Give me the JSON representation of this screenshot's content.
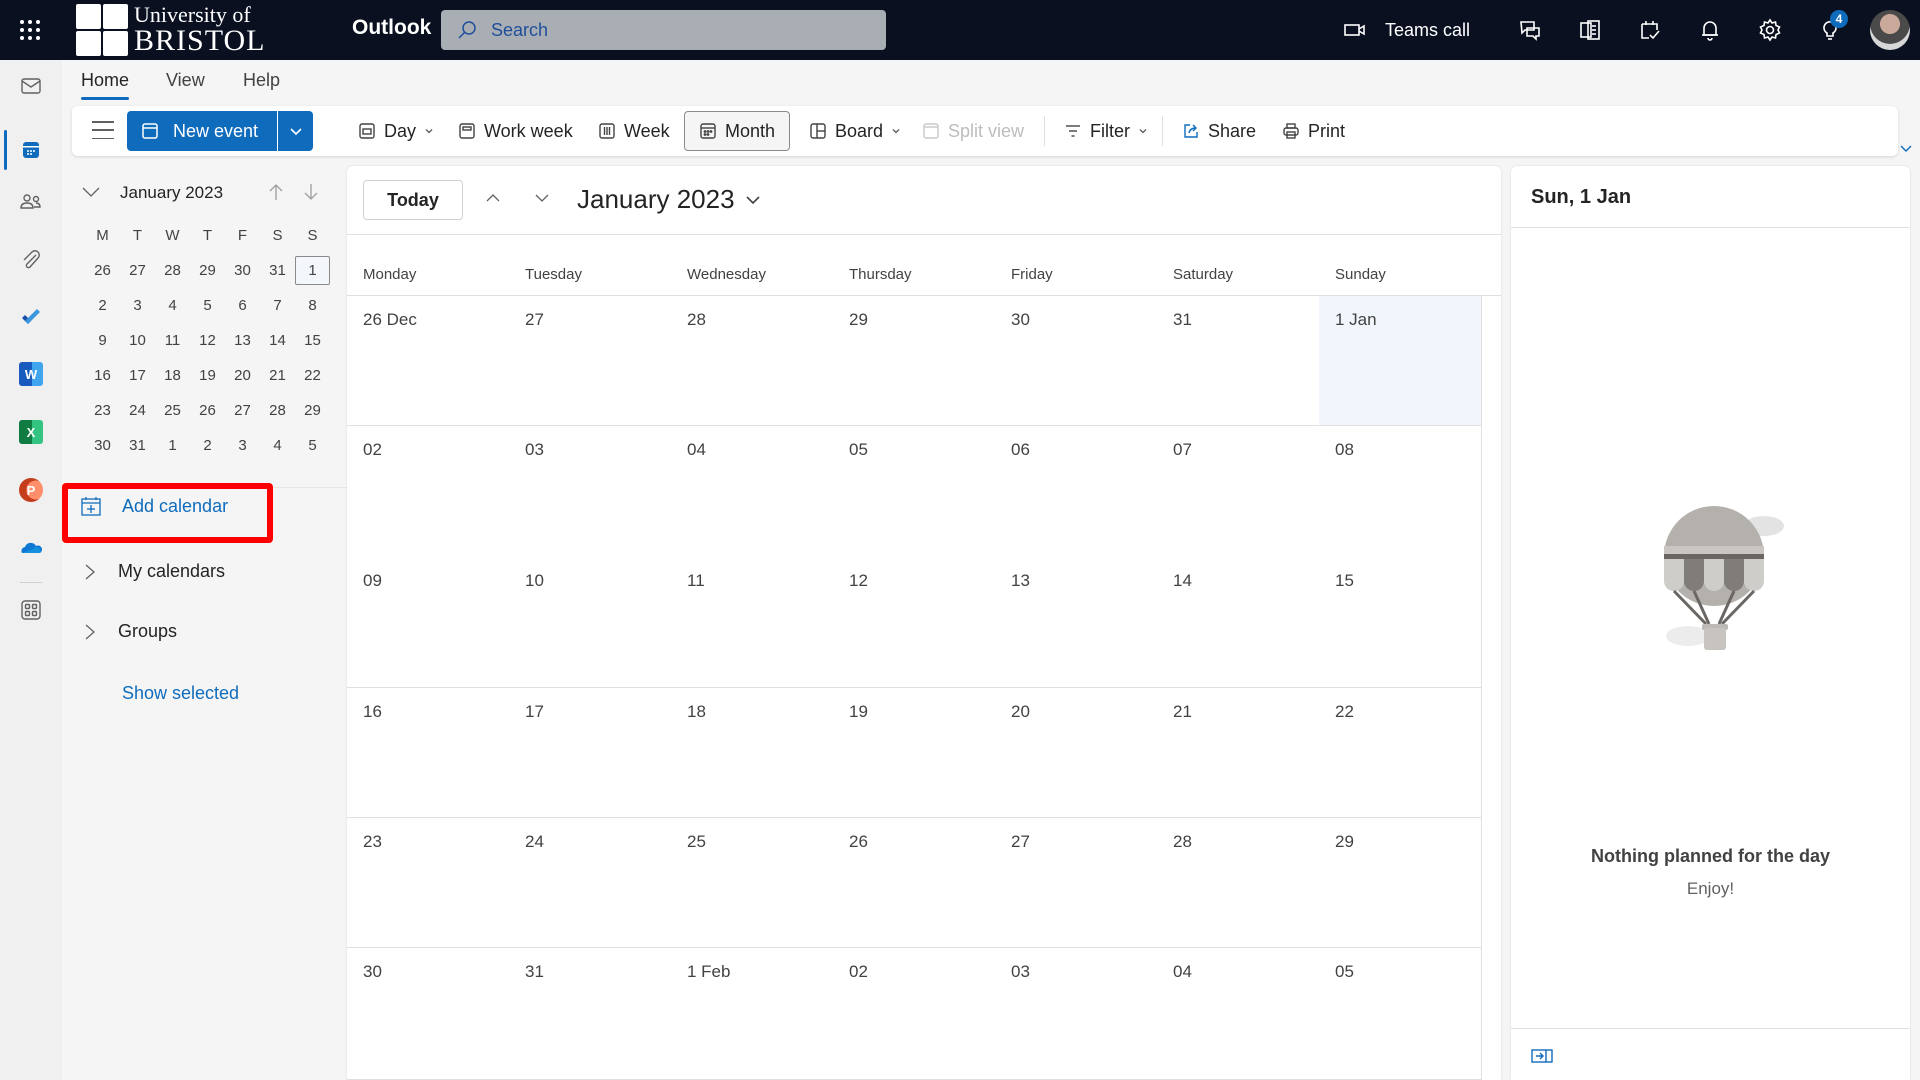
{
  "topbar": {
    "logo_line1": "University of",
    "logo_line2": "BRISTOL",
    "app_name": "Outlook",
    "search_placeholder": "Search",
    "teams_call_label": "Teams call",
    "icons": [
      "waffle-icon",
      "video-camera-icon",
      "chat-icon",
      "onenote-icon",
      "calendar-check-icon",
      "bell-icon",
      "gear-icon",
      "lightbulb-icon",
      "avatar"
    ],
    "tips_badge": "4"
  },
  "rail": {
    "items": [
      "mail",
      "calendar",
      "people",
      "files",
      "todo",
      "word",
      "excel",
      "powerpoint",
      "onedrive",
      "more-apps"
    ],
    "active": "calendar",
    "word_letter": "W",
    "excel_letter": "X",
    "powerpoint_letter": "P"
  },
  "ribbon": {
    "tabs": [
      {
        "label": "Home",
        "active": true
      },
      {
        "label": "View",
        "active": false
      },
      {
        "label": "Help",
        "active": false
      }
    ],
    "toolbar": {
      "new_event": "New event",
      "day": "Day",
      "work_week": "Work week",
      "week": "Week",
      "month": "Month",
      "board": "Board",
      "split_view": "Split view",
      "filter": "Filter",
      "share": "Share",
      "print": "Print"
    },
    "selected_view": "Month"
  },
  "mini_calendar": {
    "title": "January 2023",
    "weekday_headers": [
      "M",
      "T",
      "W",
      "T",
      "F",
      "S",
      "S"
    ],
    "weeks": [
      [
        "26",
        "27",
        "28",
        "29",
        "30",
        "31",
        "1"
      ],
      [
        "2",
        "3",
        "4",
        "5",
        "6",
        "7",
        "8"
      ],
      [
        "9",
        "10",
        "11",
        "12",
        "13",
        "14",
        "15"
      ],
      [
        "16",
        "17",
        "18",
        "19",
        "20",
        "21",
        "22"
      ],
      [
        "23",
        "24",
        "25",
        "26",
        "27",
        "28",
        "29"
      ],
      [
        "30",
        "31",
        "1",
        "2",
        "3",
        "4",
        "5"
      ]
    ],
    "selected": "1"
  },
  "folder_pane": {
    "add_calendar": "Add calendar",
    "my_calendars": "My calendars",
    "groups": "Groups",
    "show_selected": "Show selected"
  },
  "calendar": {
    "today_button": "Today",
    "title": "January 2023",
    "weekdays": [
      "Monday",
      "Tuesday",
      "Wednesday",
      "Thursday",
      "Friday",
      "Saturday",
      "Sunday"
    ],
    "weeks": [
      [
        "26 Dec",
        "27",
        "28",
        "29",
        "30",
        "31",
        "1 Jan"
      ],
      [
        "02",
        "03",
        "04",
        "05",
        "06",
        "07",
        "08"
      ],
      [
        "09",
        "10",
        "11",
        "12",
        "13",
        "14",
        "15"
      ],
      [
        "16",
        "17",
        "18",
        "19",
        "20",
        "21",
        "22"
      ],
      [
        "23",
        "24",
        "25",
        "26",
        "27",
        "28",
        "29"
      ],
      [
        "30",
        "31",
        "1 Feb",
        "02",
        "03",
        "04",
        "05"
      ]
    ],
    "selected_day": "1 Jan"
  },
  "day_panel": {
    "title": "Sun, 1 Jan",
    "empty_title": "Nothing planned for the day",
    "empty_subtitle": "Enjoy!"
  },
  "colors": {
    "accent": "#0f6cbd",
    "topbar_bg": "#0a1020",
    "highlight": "#ff0000",
    "selected_day_bg": "#f1f6fc"
  }
}
